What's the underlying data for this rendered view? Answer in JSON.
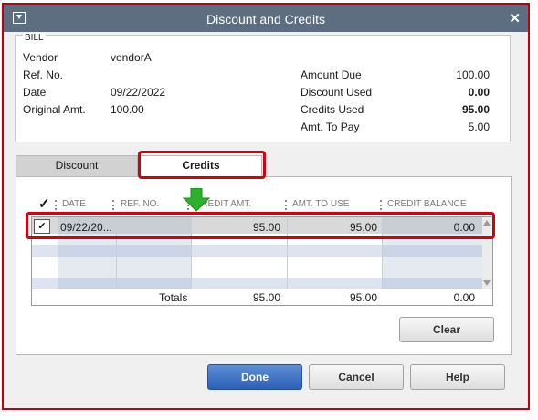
{
  "window": {
    "title": "Discount and Credits",
    "close_glyph": "✕"
  },
  "bill": {
    "section_label": "BILL",
    "vendor_label": "Vendor",
    "vendor_value": "vendorA",
    "ref_label": "Ref. No.",
    "date_label": "Date",
    "date_value": "09/22/2022",
    "orig_label": "Original Amt.",
    "orig_value": "100.00",
    "amount_due_label": "Amount Due",
    "amount_due_value": "100.00",
    "discount_used_label": "Discount Used",
    "discount_used_value": "0.00",
    "credits_used_label": "Credits Used",
    "credits_used_value": "95.00",
    "amt_to_pay_label": "Amt. To Pay",
    "amt_to_pay_value": "5.00"
  },
  "tabs": {
    "discount": "Discount",
    "credits": "Credits"
  },
  "table": {
    "check_header": "✓",
    "headers": {
      "date": "DATE",
      "ref": "REF. NO.",
      "credit_amt": "CREDIT AMT.",
      "amt_to_use": "AMT. TO USE",
      "balance": "CREDIT BALANCE"
    },
    "row": {
      "check": "✔",
      "date": "09/22/20...",
      "ref": "",
      "credit_amt": "95.00",
      "amt_to_use": "95.00",
      "balance": "0.00"
    },
    "totals": {
      "label": "Totals",
      "credit_amt": "95.00",
      "amt_to_use": "95.00",
      "balance": "0.00"
    }
  },
  "buttons": {
    "clear": "Clear",
    "done": "Done",
    "cancel": "Cancel",
    "help": "Help"
  },
  "colors": {
    "highlight": "#d40010",
    "arrow": "#2bb12b",
    "titlebar": "#5c6e80",
    "primary": "#2d5fb6"
  }
}
